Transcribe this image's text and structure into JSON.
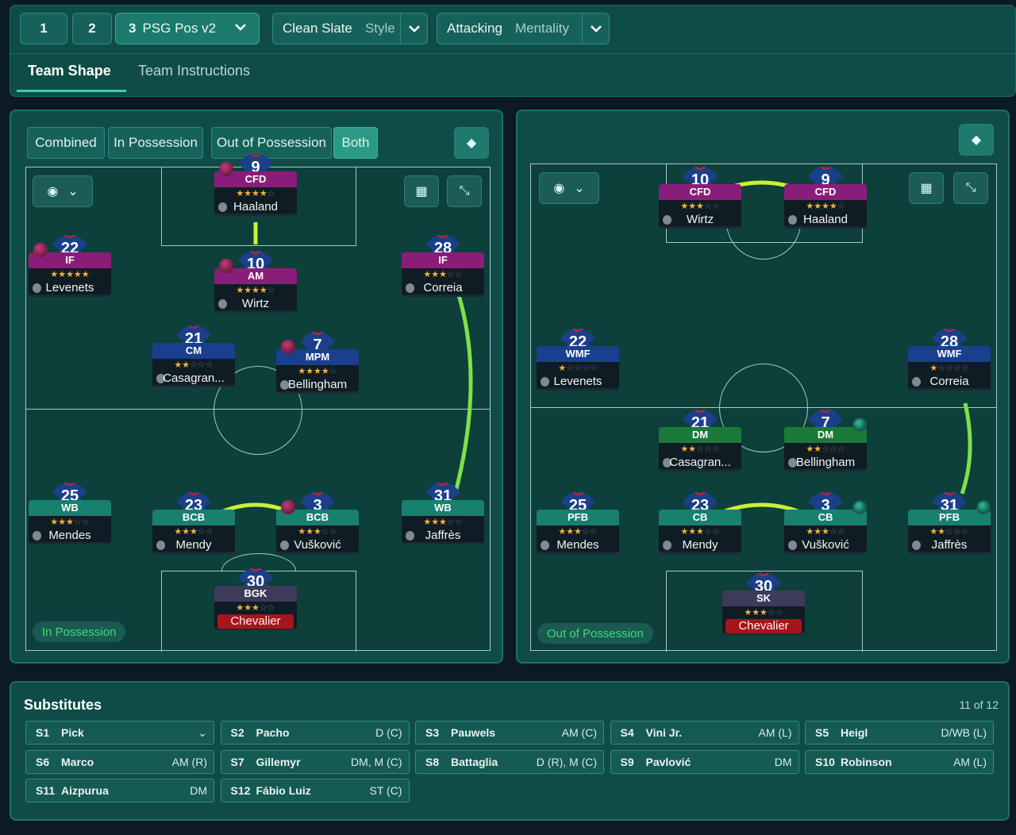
{
  "tactics": {
    "slot1": "1",
    "slot2": "2",
    "slot3_num": "3",
    "slot3_name": "PSG Pos v2",
    "style_value": "Clean Slate",
    "style_label": "Style",
    "mentality_value": "Attacking",
    "mentality_label": "Mentality"
  },
  "tabs": {
    "team_shape": "Team Shape",
    "team_instructions": "Team Instructions"
  },
  "view_modes": {
    "combined": "Combined",
    "in_possession": "In Possession",
    "out_of_possession": "Out of Possession",
    "both": "Both"
  },
  "labels": {
    "left_pitch": "In Possession",
    "right_pitch": "Out of Possession"
  },
  "left_players": [
    {
      "num": "9",
      "role": "CFD",
      "name": "Haaland",
      "stars": 3.5
    },
    {
      "num": "22",
      "role": "IF",
      "name": "Levenets",
      "stars": 4.5
    },
    {
      "num": "10",
      "role": "AM",
      "name": "Wirtz",
      "stars": 4
    },
    {
      "num": "28",
      "role": "IF",
      "name": "Correia",
      "stars": 3
    },
    {
      "num": "21",
      "role": "CM",
      "name": "Casagran...",
      "stars": 2
    },
    {
      "num": "7",
      "role": "MPM",
      "name": "Bellingham",
      "stars": 4
    },
    {
      "num": "25",
      "role": "WB",
      "name": "Mendes",
      "stars": 2.5
    },
    {
      "num": "23",
      "role": "BCB",
      "name": "Mendy",
      "stars": 3
    },
    {
      "num": "3",
      "role": "BCB",
      "name": "Vušković",
      "stars": 3
    },
    {
      "num": "31",
      "role": "WB",
      "name": "Jaffrès",
      "stars": 2.5
    },
    {
      "num": "30",
      "role": "BGK",
      "name": "Chevalier",
      "stars": 3
    }
  ],
  "right_players": [
    {
      "num": "10",
      "role": "CFD",
      "name": "Wirtz",
      "stars": 2.5
    },
    {
      "num": "9",
      "role": "CFD",
      "name": "Haaland",
      "stars": 4
    },
    {
      "num": "22",
      "role": "WMF",
      "name": "Levenets",
      "stars": 1
    },
    {
      "num": "28",
      "role": "WMF",
      "name": "Correia",
      "stars": 1
    },
    {
      "num": "21",
      "role": "DM",
      "name": "Casagran...",
      "stars": 2
    },
    {
      "num": "7",
      "role": "DM",
      "name": "Bellingham",
      "stars": 1.5
    },
    {
      "num": "25",
      "role": "PFB",
      "name": "Mendes",
      "stars": 2.5
    },
    {
      "num": "23",
      "role": "CB",
      "name": "Mendy",
      "stars": 3
    },
    {
      "num": "3",
      "role": "CB",
      "name": "Vušković",
      "stars": 3
    },
    {
      "num": "31",
      "role": "PFB",
      "name": "Jaffrès",
      "stars": 2
    },
    {
      "num": "30",
      "role": "SK",
      "name": "Chevalier",
      "stars": 3
    }
  ],
  "substitutes": {
    "title": "Substitutes",
    "count": "11 of 12",
    "items": [
      {
        "slot": "S1",
        "name": "Pick",
        "pos": ""
      },
      {
        "slot": "S2",
        "name": "Pacho",
        "pos": "D (C)"
      },
      {
        "slot": "S3",
        "name": "Pauwels",
        "pos": "AM (C)"
      },
      {
        "slot": "S4",
        "name": "Vini Jr.",
        "pos": "AM (L)"
      },
      {
        "slot": "S5",
        "name": "Heigl",
        "pos": "D/WB (L)"
      },
      {
        "slot": "S6",
        "name": "Marco",
        "pos": "AM (R)"
      },
      {
        "slot": "S7",
        "name": "Gillemyr",
        "pos": "DM, M (C)"
      },
      {
        "slot": "S8",
        "name": "Battaglia",
        "pos": "D (R), M (C)"
      },
      {
        "slot": "S9",
        "name": "Pavlović",
        "pos": "DM"
      },
      {
        "slot": "S10",
        "name": "Robinson",
        "pos": "AM (L)"
      },
      {
        "slot": "S11",
        "name": "Aizpurua",
        "pos": "DM"
      },
      {
        "slot": "S12",
        "name": "Fábio Luiz",
        "pos": "ST (C)"
      }
    ]
  },
  "colors": {
    "attack_role": "#8b1d7a",
    "mid_role": "#1a3f8f",
    "def_role": "#17806f",
    "gk_role": "#3e3a5a",
    "dm_role": "#1b7a3a",
    "link_line": "#c8f03a"
  }
}
